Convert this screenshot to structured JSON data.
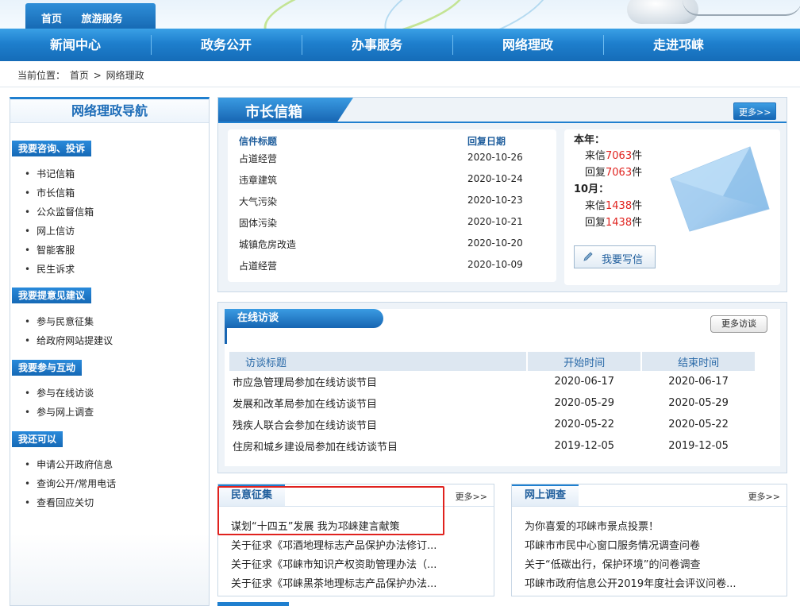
{
  "top_tabs": [
    "首页",
    "旅游服务"
  ],
  "nav": [
    "新闻中心",
    "政务公开",
    "办事服务",
    "网络理政",
    "走进邛崃"
  ],
  "breadcrumb": {
    "label": "当前位置：",
    "home": "首页",
    "sep": ">",
    "current": "网络理政"
  },
  "sidebar": {
    "title": "网络理政导航",
    "groups": [
      {
        "label": "我要咨询、投诉",
        "items": [
          "书记信箱",
          "市长信箱",
          "公众监督信箱",
          "网上信访",
          "智能客服",
          "民生诉求"
        ]
      },
      {
        "label": "我要提意见建议",
        "items": [
          "参与民意征集",
          "给政府网站提建议"
        ]
      },
      {
        "label": "我要参与互动",
        "items": [
          "参与在线访谈",
          "参与网上调查"
        ]
      },
      {
        "label": "我还可以",
        "items": [
          "申请公开政府信息",
          "查询公开/常用电话",
          "查看回应关切"
        ]
      }
    ]
  },
  "mailbox": {
    "title": "市长信箱",
    "more": "更多>>",
    "col_title": "信件标题",
    "col_date": "回复日期",
    "rows": [
      {
        "title": "占道经营",
        "date": "2020-10-26"
      },
      {
        "title": "违章建筑",
        "date": "2020-10-24"
      },
      {
        "title": "大气污染",
        "date": "2020-10-23"
      },
      {
        "title": "固体污染",
        "date": "2020-10-21"
      },
      {
        "title": "城镇危房改造",
        "date": "2020-10-20"
      },
      {
        "title": "占道经营",
        "date": "2020-10-09"
      }
    ],
    "stats": {
      "year_label": "本年：",
      "year_in_prefix": "来信",
      "year_in": "7063",
      "year_in_suffix": "件",
      "year_reply_prefix": "回复",
      "year_reply": "7063",
      "year_reply_suffix": "件",
      "month_label": "10月：",
      "month_in_prefix": "来信",
      "month_in": "1438",
      "month_in_suffix": "件",
      "month_reply_prefix": "回复",
      "month_reply": "1438",
      "month_reply_suffix": "件"
    },
    "write_btn": "我要写信"
  },
  "interviews": {
    "title": "在线访谈",
    "more": "更多访谈",
    "columns": [
      "访谈标题",
      "开始时间",
      "结束时间"
    ],
    "rows": [
      {
        "title": "市应急管理局参加在线访谈节目",
        "start": "2020-06-17",
        "end": "2020-06-17"
      },
      {
        "title": "发展和改革局参加在线访谈节目",
        "start": "2020-05-29",
        "end": "2020-05-29"
      },
      {
        "title": "残疾人联合会参加在线访谈节目",
        "start": "2020-05-22",
        "end": "2020-05-22"
      },
      {
        "title": "住房和城乡建设局参加在线访谈节目",
        "start": "2019-12-05",
        "end": "2019-12-05"
      }
    ]
  },
  "opinion": {
    "title": "民意征集",
    "more": "更多>>",
    "items": [
      "谋划“十四五”发展  我为邛崃建言献策",
      "关于征求《邛酒地理标志产品保护办法修订...",
      "关于征求《邛崃市知识产权资助管理办法（...",
      "关于征求《邛崃黑茶地理标志产品保护办法..."
    ]
  },
  "survey": {
    "title": "网上调查",
    "more": "更多>>",
    "items": [
      "为你喜爱的邛崃市景点投票！",
      "邛崃市市民中心窗口服务情况调查问卷",
      "关于“低碳出行，保护环境”的问卷调查",
      "邛崃市政府信息公开2019年度社会评议问卷..."
    ]
  },
  "colors": {
    "nav_blue": "#1e7fcd",
    "accent_red": "#e0221e",
    "link_blue": "#1e5d9c"
  }
}
